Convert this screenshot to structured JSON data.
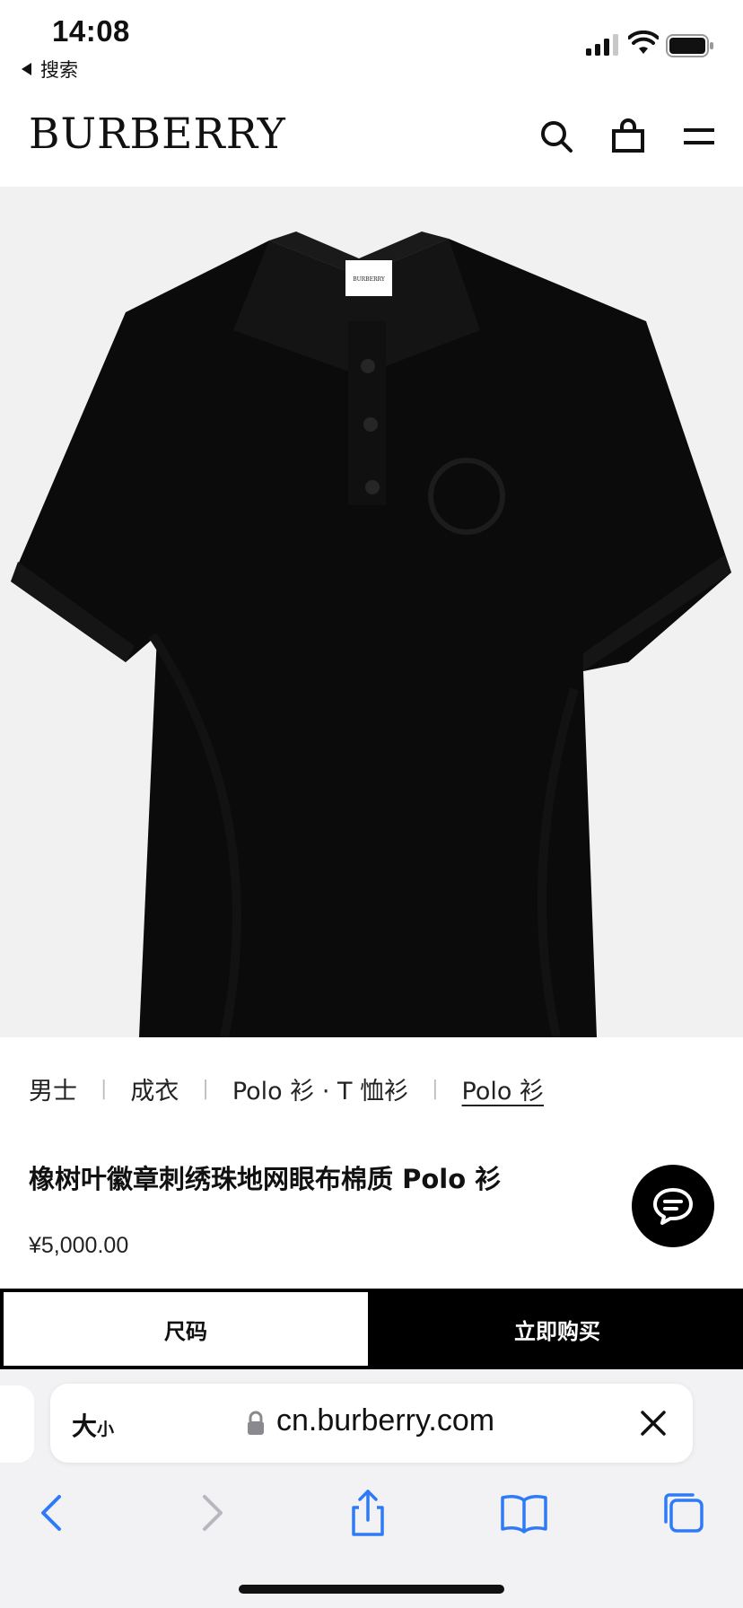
{
  "status_bar": {
    "time": "14:08",
    "back_label": "搜索",
    "signal_icon": "signal-icon",
    "wifi_icon": "wifi-icon",
    "battery_icon": "battery-icon"
  },
  "header": {
    "logo": "BURBERRY",
    "icons": [
      "search-icon",
      "shopping-bag-icon",
      "menu-icon"
    ]
  },
  "product": {
    "breadcrumb": [
      "男士",
      "成衣",
      "Polo 衫 · T 恤衫",
      "Polo 衫"
    ],
    "title": "橡树叶徽章刺绣珠地网眼布棉质 Polo 衫",
    "price": "¥5,000.00",
    "label_text": "BURBERRY"
  },
  "actions": {
    "size_label": "尺码",
    "buy_label": "立即购买"
  },
  "browser": {
    "text_size_big": "大",
    "text_size_small": "小",
    "url": "cn.burberry.com",
    "toolbar_icons": [
      "back-icon",
      "forward-icon",
      "share-icon",
      "bookmarks-icon",
      "tabs-icon"
    ]
  },
  "colors": {
    "accent": "#2f7bf6",
    "disabled": "#b7b7bd",
    "black": "#000000"
  }
}
